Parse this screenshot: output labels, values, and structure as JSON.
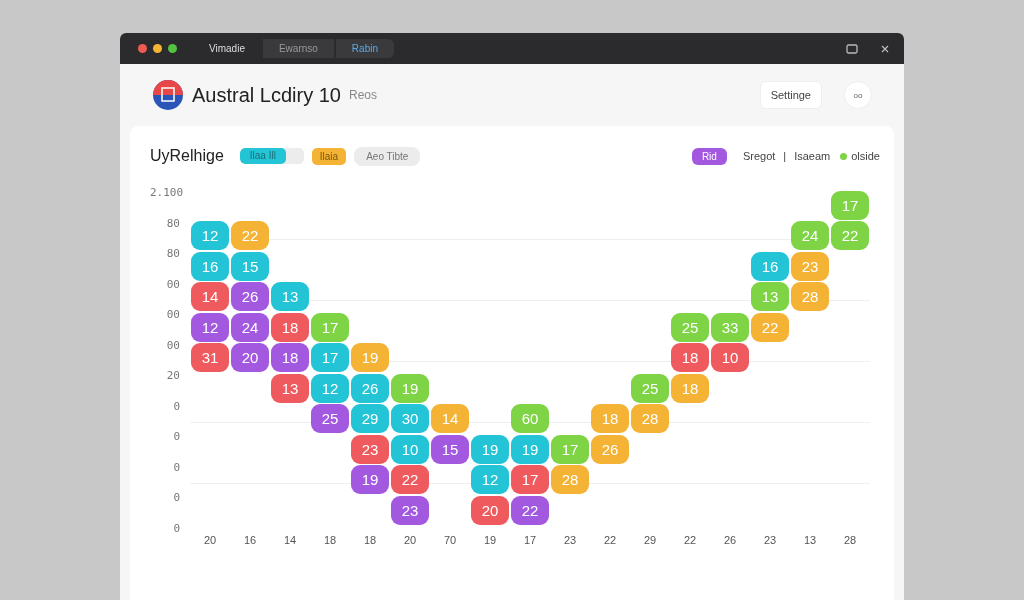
{
  "window": {
    "tabs": [
      {
        "label": "Vimadie",
        "selected": false
      },
      {
        "label": "Ewarnso",
        "selected": false
      },
      {
        "label": "Rabin",
        "selected": true
      }
    ]
  },
  "header": {
    "title": "Austral Lcdiry 10",
    "subtitle": "Reos",
    "button": "Settinge",
    "icon_button": "oo"
  },
  "toolbar": {
    "heading": "UyRelhige",
    "chips": [
      {
        "kind": "progress",
        "label": "Ilaa Ill",
        "color": "#22c4d6",
        "level": 0.72
      },
      {
        "kind": "solid",
        "label": "Ilaia",
        "color": "#f5b335"
      },
      {
        "kind": "plain",
        "label": "Aeo Tibte",
        "color": "#ececec"
      }
    ],
    "badge": {
      "label": "Rid",
      "color": "#a259e0"
    },
    "links": [
      "Sregot",
      "|",
      "Isaeam"
    ],
    "legend": {
      "label": "olside",
      "color": "#7ed445"
    }
  },
  "y_labels": [
    "2.100",
    "80",
    "80",
    "00",
    "00",
    "00",
    "20",
    "0",
    "0",
    "0",
    "0",
    "0"
  ],
  "columns": [
    {
      "label": "20",
      "tiles": [
        {
          "value": "12",
          "color": "#22c4d6"
        },
        {
          "value": "16",
          "color": "#22c4d6"
        },
        {
          "value": "14",
          "color": "#ef5a5f"
        },
        {
          "value": "12",
          "color": "#a259e0"
        },
        {
          "value": "31",
          "color": "#ef5a5f"
        }
      ]
    },
    {
      "label": "16",
      "tiles": [
        {
          "value": "22",
          "color": "#f5b335"
        },
        {
          "value": "15",
          "color": "#22c4d6"
        },
        {
          "value": "26",
          "color": "#a259e0"
        },
        {
          "value": "24",
          "color": "#a259e0"
        },
        {
          "value": "20",
          "color": "#a259e0"
        }
      ]
    },
    {
      "label": "14",
      "tiles": [
        {
          "value": "13",
          "color": "#22c4d6"
        },
        {
          "value": "18",
          "color": "#ef5a5f"
        },
        {
          "value": "18",
          "color": "#a259e0"
        },
        {
          "value": "13",
          "color": "#ef5a5f"
        }
      ]
    },
    {
      "label": "18",
      "tiles": [
        {
          "value": "17",
          "color": "#7ed445"
        },
        {
          "value": "17",
          "color": "#22c4d6"
        },
        {
          "value": "12",
          "color": "#22c4d6"
        },
        {
          "value": "25",
          "color": "#a259e0"
        }
      ]
    },
    {
      "label": "18",
      "tiles": [
        {
          "value": "19",
          "color": "#f5b335"
        },
        {
          "value": "26",
          "color": "#22c4d6"
        },
        {
          "value": "29",
          "color": "#22c4d6"
        },
        {
          "value": "23",
          "color": "#ef5a5f"
        },
        {
          "value": "19",
          "color": "#a259e0"
        }
      ]
    },
    {
      "label": "20",
      "tiles": [
        {
          "value": "19",
          "color": "#7ed445"
        },
        {
          "value": "30",
          "color": "#22c4d6"
        },
        {
          "value": "10",
          "color": "#22c4d6"
        },
        {
          "value": "22",
          "color": "#ef5a5f"
        },
        {
          "value": "23",
          "color": "#a259e0"
        }
      ]
    },
    {
      "label": "70",
      "tiles": [
        {
          "value": "14",
          "color": "#f5b335"
        },
        {
          "value": "15",
          "color": "#a259e0"
        }
      ]
    },
    {
      "label": "19",
      "tiles": [
        {
          "value": "19",
          "color": "#22c4d6"
        },
        {
          "value": "12",
          "color": "#22c4d6"
        },
        {
          "value": "20",
          "color": "#ef5a5f"
        }
      ]
    },
    {
      "label": "17",
      "tiles": [
        {
          "value": "60",
          "color": "#7ed445"
        },
        {
          "value": "19",
          "color": "#22c4d6"
        },
        {
          "value": "17",
          "color": "#ef5a5f"
        },
        {
          "value": "22",
          "color": "#a259e0"
        }
      ]
    },
    {
      "label": "23",
      "tiles": [
        {
          "value": "17",
          "color": "#7ed445"
        },
        {
          "value": "28",
          "color": "#f5b335"
        }
      ]
    },
    {
      "label": "22",
      "tiles": [
        {
          "value": "18",
          "color": "#f5b335"
        },
        {
          "value": "26",
          "color": "#f5b335"
        }
      ]
    },
    {
      "label": "29",
      "tiles": [
        {
          "value": "25",
          "color": "#7ed445"
        },
        {
          "value": "28",
          "color": "#f5b335"
        }
      ]
    },
    {
      "label": "22",
      "tiles": [
        {
          "value": "25",
          "color": "#7ed445"
        },
        {
          "value": "18",
          "color": "#ef5a5f"
        },
        {
          "value": "18",
          "color": "#f5b335"
        }
      ]
    },
    {
      "label": "26",
      "tiles": [
        {
          "value": "33",
          "color": "#7ed445"
        },
        {
          "value": "10",
          "color": "#ef5a5f"
        }
      ]
    },
    {
      "label": "23",
      "tiles": [
        {
          "value": "16",
          "color": "#22c4d6"
        },
        {
          "value": "13",
          "color": "#7ed445"
        },
        {
          "value": "22",
          "color": "#f5b335"
        }
      ]
    },
    {
      "label": "13",
      "tiles": [
        {
          "value": "24",
          "color": "#7ed445"
        },
        {
          "value": "23",
          "color": "#f5b335"
        },
        {
          "value": "28",
          "color": "#f5b335"
        }
      ]
    },
    {
      "label": "28",
      "tiles": [
        {
          "value": "17",
          "color": "#7ed445"
        },
        {
          "value": "22",
          "color": "#7ed445"
        }
      ]
    }
  ]
}
